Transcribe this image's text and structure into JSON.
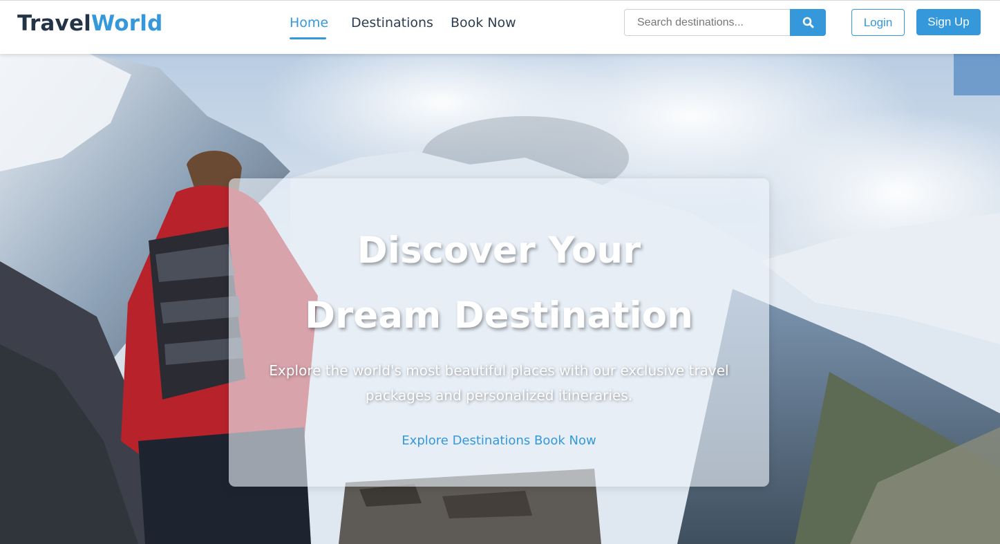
{
  "brand": {
    "part1": "Travel",
    "part2": "World"
  },
  "nav": {
    "items": [
      {
        "label": "Home",
        "active": true
      },
      {
        "label": "Destinations",
        "active": false
      },
      {
        "label": "Book Now",
        "active": false
      }
    ]
  },
  "search": {
    "placeholder": "Search destinations...",
    "value": "",
    "icon": "search-icon"
  },
  "auth": {
    "login_label": "Login",
    "signup_label": "Sign Up"
  },
  "hero": {
    "title": "Discover Your Dream Destination",
    "subtitle": "Explore the world's most beautiful places with our exclusive travel packages and personalized itineraries.",
    "link_explore": "Explore Destinations",
    "link_book": "Book Now",
    "image": "hiker-with-backpack-overlooking-snowy-mountain-valley"
  },
  "colors": {
    "accent": "#3498db",
    "brand_dark": "#243447",
    "nav_text": "#2c3e50"
  }
}
